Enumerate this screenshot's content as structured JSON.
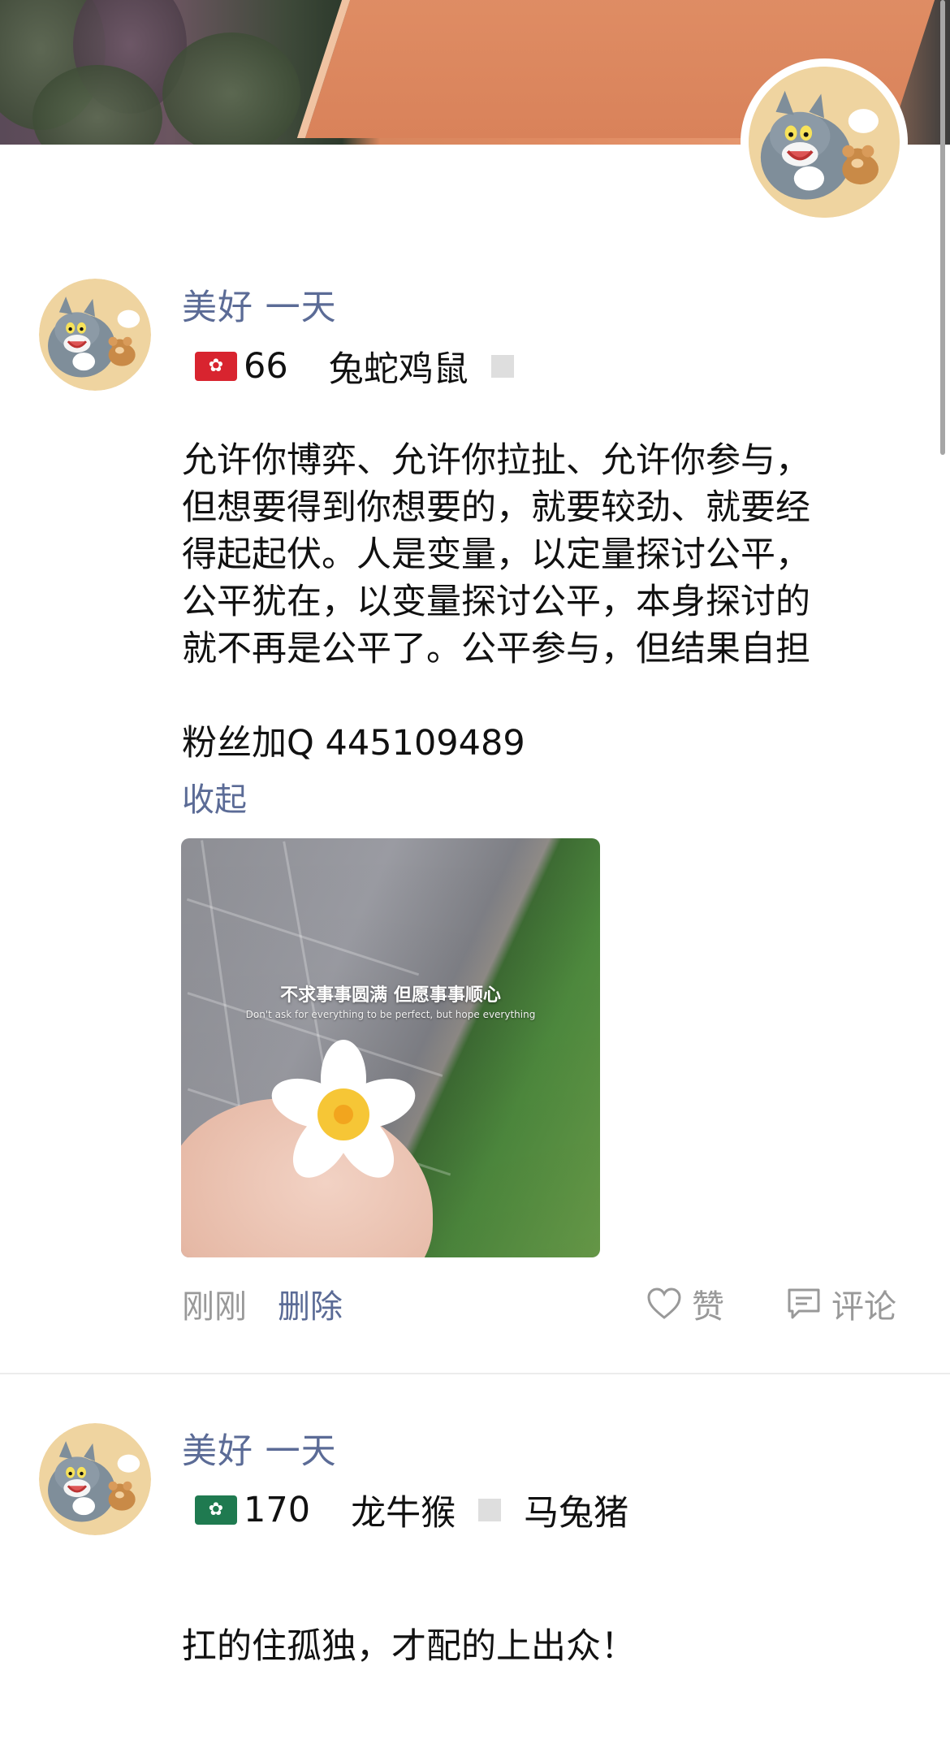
{
  "cover": {
    "image": "cover-photo"
  },
  "posts": [
    {
      "nickname": "美好 一天",
      "region_flag": "hong-kong-flag-icon",
      "number": "66",
      "tag_a": "兔蛇鸡鼠",
      "tag_b": "",
      "content": "允许你博弈、允许你拉扯、允许你参与，\n但想要得到你想要的，就要较劲、就要经\n得起起伏。人是变量，以定量探讨公平，\n公平犹在，以变量探讨公平，本身探讨的\n就不再是公平了。公平参与，但结果自担\n\n粉丝加Q 445109489",
      "collapse_label": "收起",
      "photo_caption": "不求事事圆满 但愿事事顺心",
      "photo_subcaption": "Don't ask for everything to be perfect, but hope everything",
      "time": "刚刚",
      "delete_label": "删除",
      "like_label": "赞",
      "comment_label": "评论"
    },
    {
      "nickname": "美好 一天",
      "region_flag": "macau-flag-icon",
      "number": "170",
      "tag_a": "龙牛猴",
      "tag_b": "马兔猪",
      "content": "扛的住孤独，才配的上出众！"
    }
  ],
  "colors": {
    "link": "#5b6b96",
    "muted": "#999999",
    "text": "#111111"
  }
}
